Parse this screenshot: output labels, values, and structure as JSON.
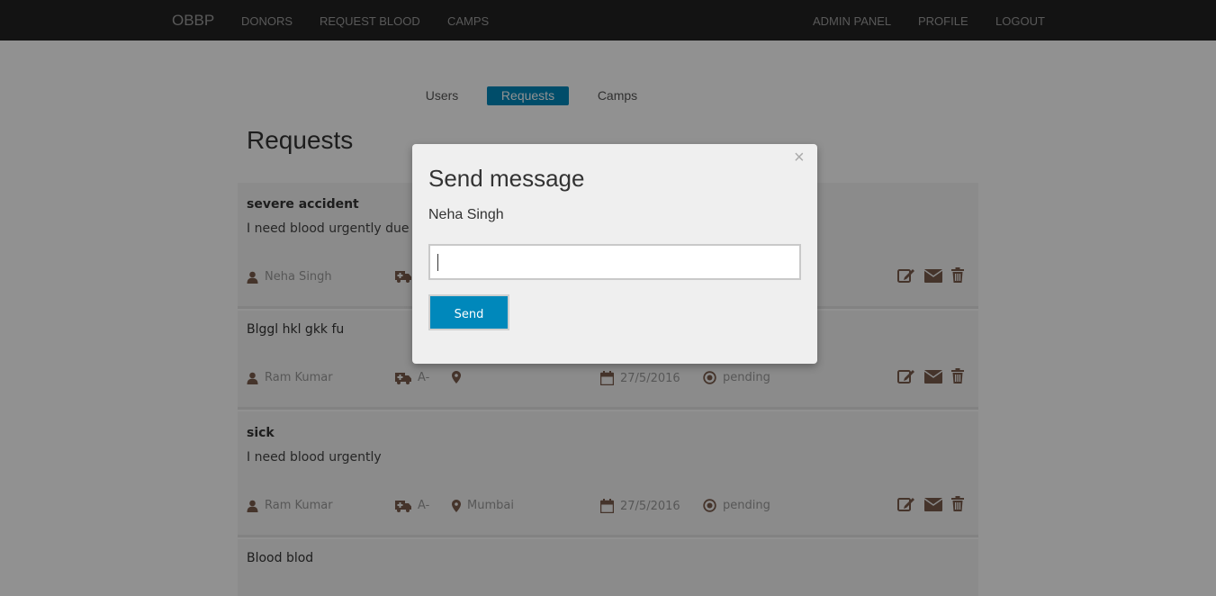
{
  "navbar": {
    "brand": "OBBP",
    "left_links": [
      "DONORS",
      "REQUEST BLOOD",
      "CAMPS"
    ],
    "right_links": [
      "ADMIN PANEL",
      "PROFILE",
      "LOGOUT"
    ]
  },
  "admin_tabs": [
    {
      "label": "Users",
      "active": false
    },
    {
      "label": "Requests",
      "active": true
    },
    {
      "label": "Camps",
      "active": false
    }
  ],
  "page_title": "Requests",
  "requests": [
    {
      "title": "severe accident",
      "title_bold": true,
      "description": "I need blood urgently due to",
      "user": "Neha Singh",
      "blood_group": "",
      "location": "",
      "date": "",
      "status": ""
    },
    {
      "title": "Blggl hkl gkk fu",
      "title_bold": false,
      "description": "",
      "user": "Ram Kumar",
      "blood_group": "A-",
      "location": "",
      "date": "27/5/2016",
      "status": "pending"
    },
    {
      "title": "sick",
      "title_bold": true,
      "description": "I need blood urgently",
      "user": "Ram Kumar",
      "blood_group": "A-",
      "location": "Mumbai",
      "date": "27/5/2016",
      "status": "pending"
    },
    {
      "title": "Blood blod",
      "title_bold": false,
      "description": "",
      "user": "",
      "blood_group": "",
      "location": "",
      "date": "",
      "status": ""
    }
  ],
  "icons": {
    "user": "user-icon",
    "blood_group": "ambulance-icon",
    "location": "map-marker-icon",
    "date": "calendar-icon",
    "status": "target-icon",
    "edit": "edit-icon",
    "message": "envelope-icon",
    "delete": "trash-icon"
  },
  "modal": {
    "title": "Send message",
    "close_symbol": "×",
    "recipient": "Neha Singh",
    "input_value": "",
    "send_label": "Send"
  },
  "colors": {
    "navbar_bg": "#222222",
    "accent": "#0088bb",
    "card_bg": "#f4f4f4",
    "meta_icon": "#7a5c4c"
  }
}
